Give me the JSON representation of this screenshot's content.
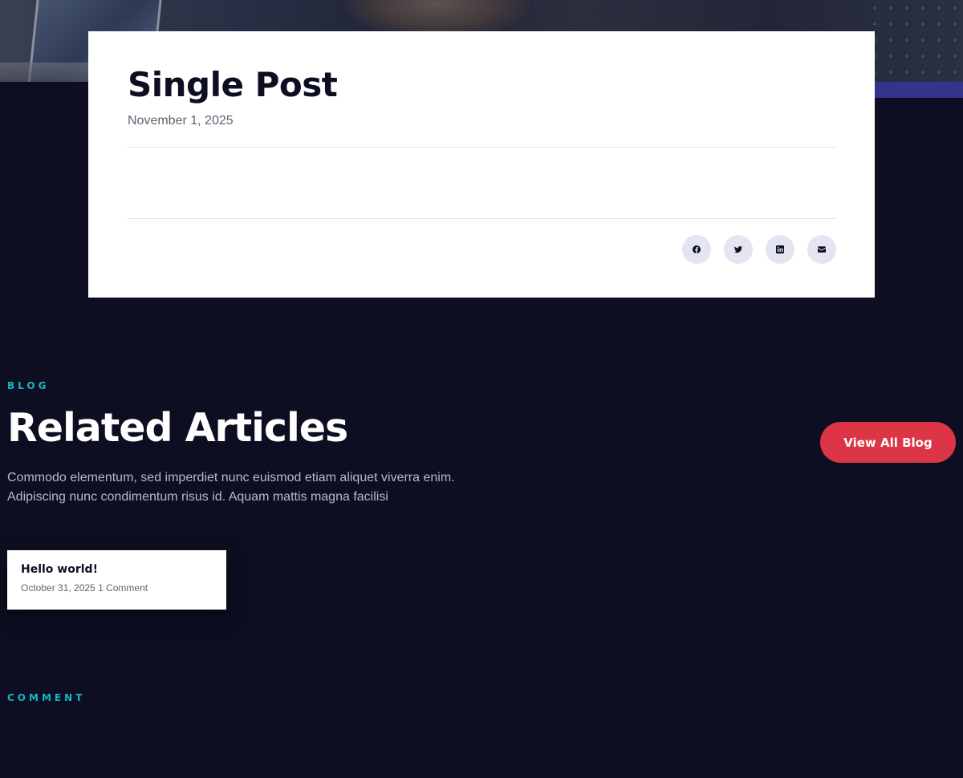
{
  "post": {
    "title": "Single Post",
    "date": "November 1, 2025"
  },
  "share": [
    {
      "name": "facebook-icon"
    },
    {
      "name": "twitter-icon"
    },
    {
      "name": "linkedin-icon"
    },
    {
      "name": "email-icon"
    }
  ],
  "related": {
    "eyebrow": "BLOG",
    "title": "Related Articles",
    "description_line1": "Commodo elementum, sed imperdiet nunc euismod etiam aliquet viverra enim.",
    "description_line2": "Adipiscing nunc condimentum risus id. Aquam mattis magna facilisi",
    "view_all_label": "View All Blog",
    "articles": [
      {
        "title": "Hello world!",
        "date": "October 31, 2025",
        "comments": "1 Comment"
      }
    ]
  },
  "comment": {
    "eyebrow": "COMMENT"
  },
  "colors": {
    "background": "#0d0e21",
    "accent_teal": "#15b7c4",
    "button_red": "#dc3545",
    "accent_bar": "#34358a"
  }
}
